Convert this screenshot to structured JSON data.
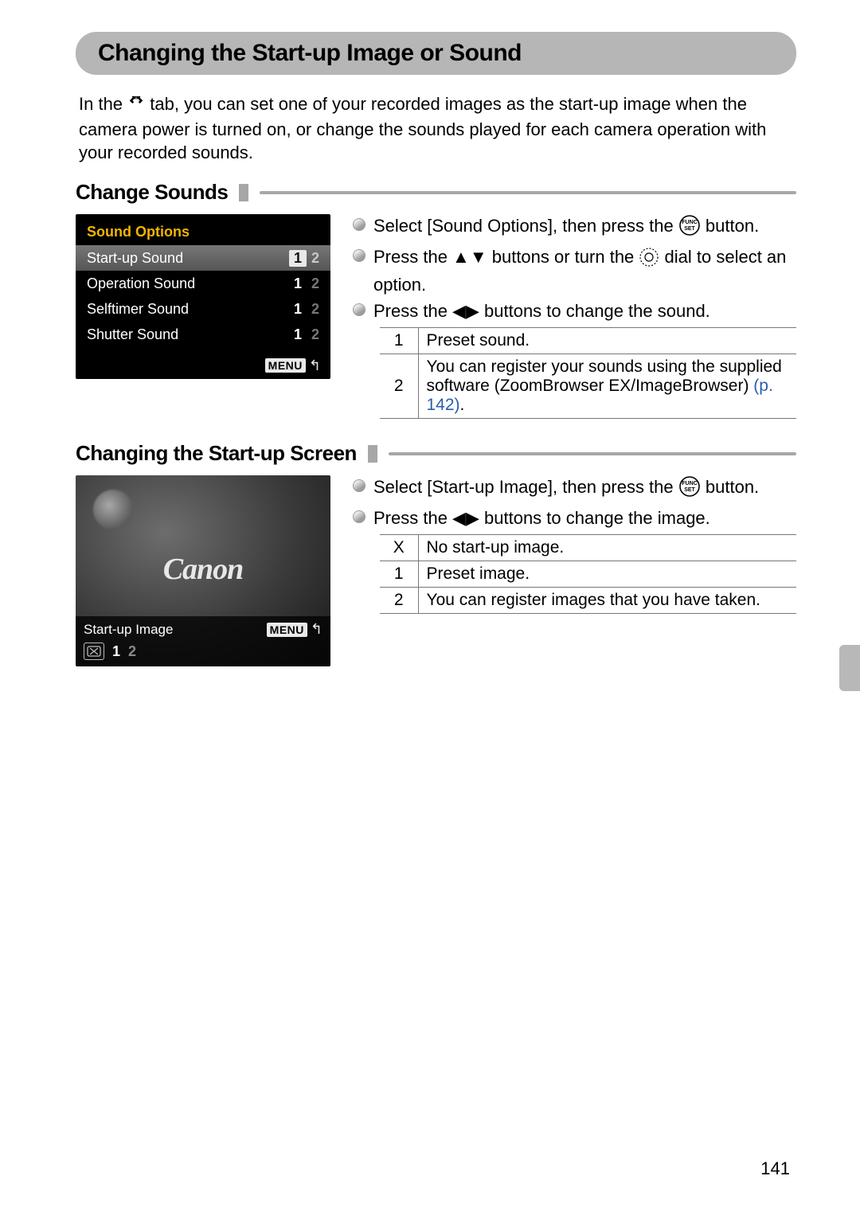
{
  "title": "Changing the Start-up Image or Sound",
  "intro_before_icon": "In the ",
  "intro_after_icon": " tab, you can set one of your recorded images as the start-up image when the camera power is turned on, or change the sounds played for each camera operation with your recorded sounds.",
  "section1": {
    "heading": "Change Sounds",
    "lcd": {
      "title": "Sound Options",
      "rows": [
        {
          "label": "Start-up Sound",
          "sel": true,
          "opts": [
            "1",
            "2"
          ],
          "active": 0
        },
        {
          "label": "Operation Sound",
          "sel": false,
          "opts": [
            "1",
            "2"
          ],
          "active": 0
        },
        {
          "label": "Selftimer Sound",
          "sel": false,
          "opts": [
            "1",
            "2"
          ],
          "active": 0
        },
        {
          "label": "Shutter Sound",
          "sel": false,
          "opts": [
            "1",
            "2"
          ],
          "active": 0
        }
      ],
      "menu": "MENU"
    },
    "bullets": {
      "b1a": "Select [Sound Options], then press the ",
      "b1b": " button.",
      "b2a": "Press the ",
      "b2b": " buttons or turn the ",
      "b2c": " dial to select an option.",
      "b3a": "Press the ",
      "b3b": " buttons to change the sound."
    },
    "table": [
      {
        "k": "1",
        "v": "Preset sound."
      },
      {
        "k": "2",
        "v": "You can register your sounds using the supplied software (ZoomBrowser EX/ImageBrowser) ",
        "ref": "(p. 142)",
        "tail": "."
      }
    ]
  },
  "section2": {
    "heading": "Changing the Start-up Screen",
    "lcd": {
      "brand": "Canon",
      "label": "Start-up Image",
      "menu": "MENU",
      "opts": {
        "x": "✕",
        "o1": "1",
        "o2": "2"
      }
    },
    "bullets": {
      "b1a": "Select [Start-up Image], then press the ",
      "b1b": " button.",
      "b2a": "Press the ",
      "b2b": " buttons to change the image."
    },
    "table": [
      {
        "k": "X",
        "v": "No start-up image."
      },
      {
        "k": "1",
        "v": "Preset image."
      },
      {
        "k": "2",
        "v": "You can register images that you have taken."
      }
    ]
  },
  "page_number": "141"
}
